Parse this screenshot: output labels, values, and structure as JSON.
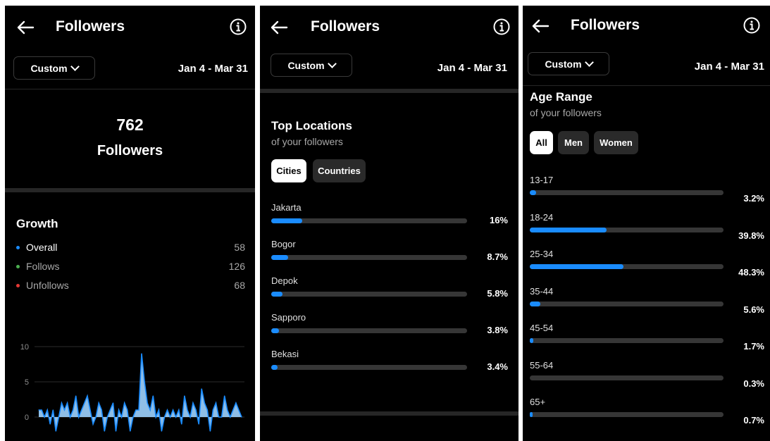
{
  "common": {
    "title": "Followers",
    "filter_label": "Custom",
    "date_range": "Jan 4 - Mar 31"
  },
  "overview": {
    "count": "762",
    "count_label": "Followers"
  },
  "growth": {
    "title": "Growth",
    "items": [
      {
        "label": "Overall",
        "value": "58",
        "color": "#1a8cff"
      },
      {
        "label": "Follows",
        "value": "126",
        "color": "#4caf50"
      },
      {
        "label": "Unfollows",
        "value": "68",
        "color": "#e53935"
      }
    ]
  },
  "chart_data": {
    "type": "area",
    "title": "",
    "xlabel": "",
    "ylabel": "",
    "ylim": [
      -4,
      10
    ],
    "yticks": [
      "10",
      "5",
      "0"
    ],
    "grid": true,
    "series": [
      {
        "values": [
          1,
          1,
          0,
          1,
          -1,
          1,
          -2,
          0,
          2,
          1,
          2,
          0,
          1,
          3,
          0,
          1,
          2,
          3,
          1,
          -1,
          0,
          2,
          1,
          -2,
          0,
          1,
          2,
          -2,
          1,
          0,
          2,
          1,
          -2,
          0,
          1,
          1,
          9,
          5,
          2,
          1,
          3,
          0,
          1,
          -2,
          0,
          1,
          0,
          1,
          0,
          1,
          -1,
          3,
          1,
          0,
          2,
          1,
          -1,
          4,
          2,
          1,
          -2,
          1,
          2,
          0,
          0,
          3,
          1,
          0,
          1,
          2,
          1,
          0
        ]
      }
    ]
  },
  "locations": {
    "title": "Top Locations",
    "subtitle": "of your followers",
    "tabs": [
      "Cities",
      "Countries"
    ],
    "active_tab": "Cities",
    "rows": [
      {
        "label": "Jakarta",
        "pct_text": "16%",
        "fraction": 0.16
      },
      {
        "label": "Bogor",
        "pct_text": "8.7%",
        "fraction": 0.087
      },
      {
        "label": "Depok",
        "pct_text": "5.8%",
        "fraction": 0.058
      },
      {
        "label": "Sapporo",
        "pct_text": "3.8%",
        "fraction": 0.038
      },
      {
        "label": "Bekasi",
        "pct_text": "3.4%",
        "fraction": 0.034
      }
    ]
  },
  "age": {
    "title": "Age Range",
    "subtitle": "of your followers",
    "tabs": [
      "All",
      "Men",
      "Women"
    ],
    "active_tab": "All",
    "rows": [
      {
        "label": "13-17",
        "pct_text": "3.2%",
        "fraction": 0.032
      },
      {
        "label": "18-24",
        "pct_text": "39.8%",
        "fraction": 0.398
      },
      {
        "label": "25-34",
        "pct_text": "48.3%",
        "fraction": 0.483
      },
      {
        "label": "35-44",
        "pct_text": "5.6%",
        "fraction": 0.056
      },
      {
        "label": "45-54",
        "pct_text": "1.7%",
        "fraction": 0.017
      },
      {
        "label": "55-64",
        "pct_text": "0.3%",
        "fraction": 0.003
      },
      {
        "label": "65+",
        "pct_text": "0.7%",
        "fraction": 0.007
      }
    ]
  },
  "colors": {
    "accent": "#1a8cff",
    "track": "#363636",
    "background": "#000000"
  }
}
